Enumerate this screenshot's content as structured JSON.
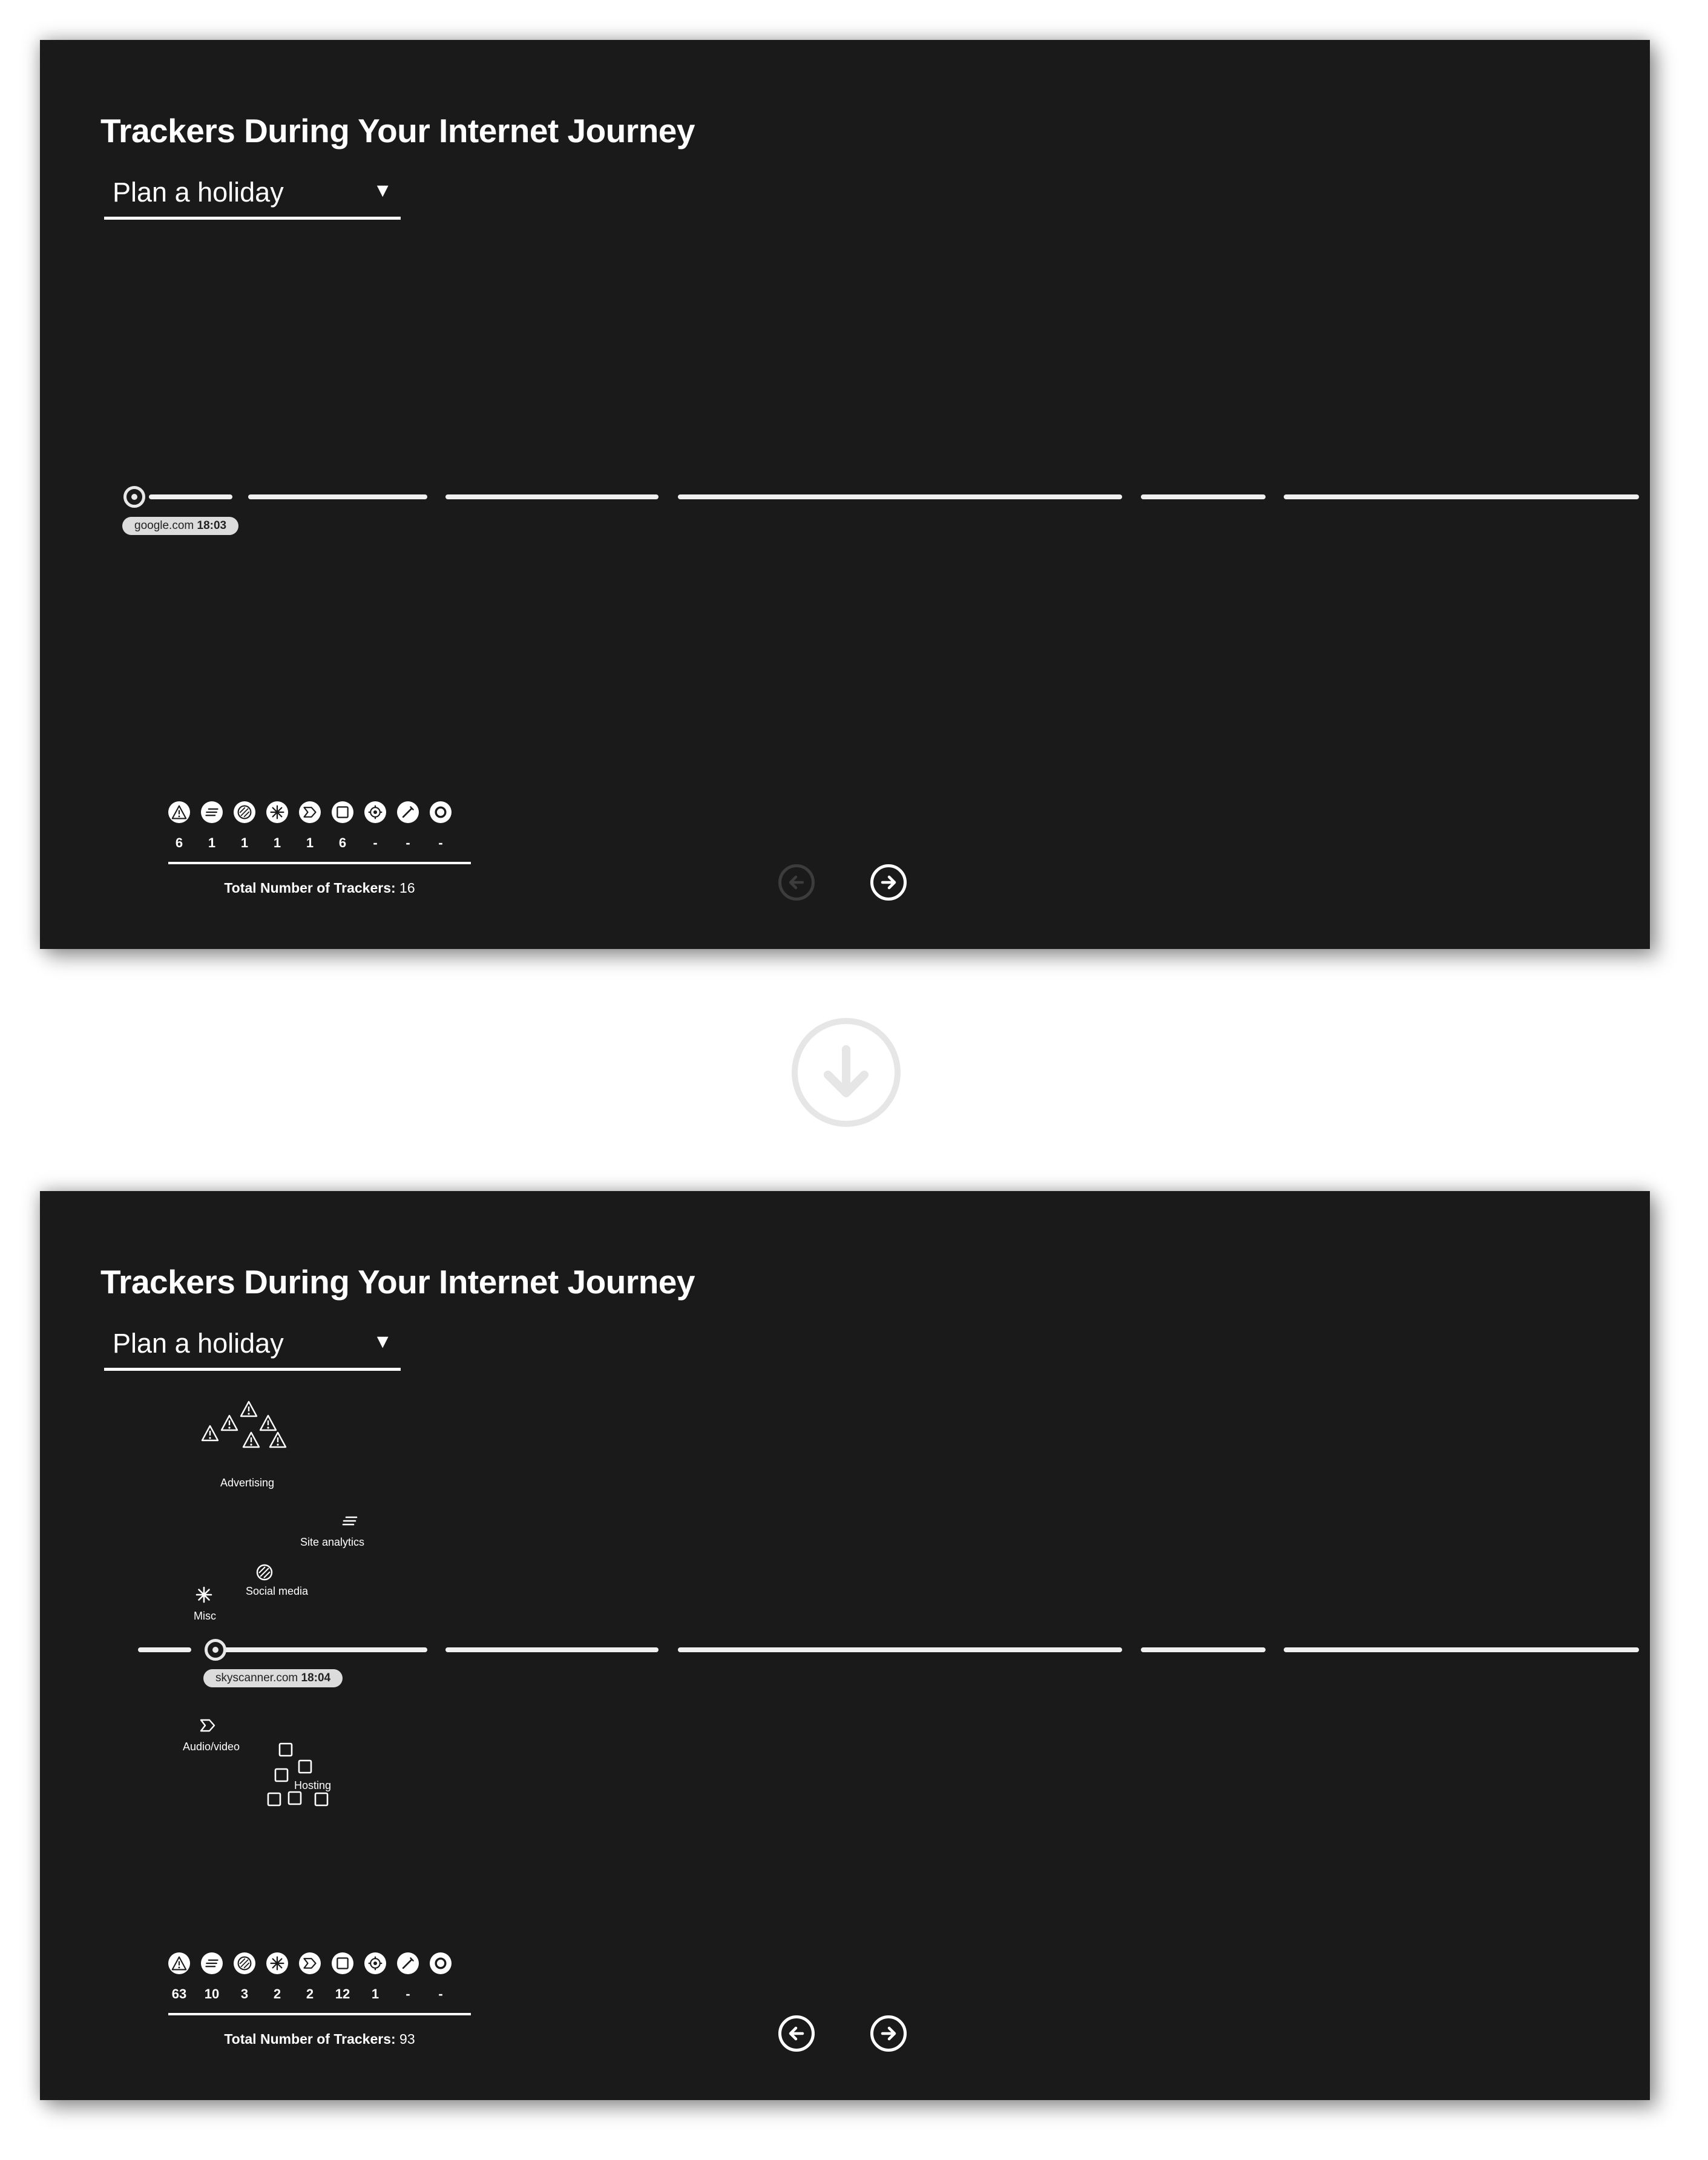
{
  "panels": [
    {
      "title": "Trackers During Your Internet Journey",
      "selector": {
        "value": "Plan a holiday",
        "caret": "▼"
      },
      "current_site": {
        "domain": "google.com",
        "time": "18:03"
      },
      "counts": [
        "6",
        "1",
        "1",
        "1",
        "1",
        "6",
        "-",
        "-",
        "-"
      ],
      "total_label": "Total Number of Trackers:",
      "total_value": "16",
      "prev_enabled": false,
      "next_enabled": true
    },
    {
      "title": "Trackers During Your Internet Journey",
      "selector": {
        "value": "Plan a holiday",
        "caret": "▼"
      },
      "current_site": {
        "domain": "skyscanner.com",
        "time": "18:04"
      },
      "counts": [
        "63",
        "10",
        "3",
        "2",
        "2",
        "12",
        "1",
        "-",
        "-"
      ],
      "total_label": "Total Number of Trackers:",
      "total_value": "93",
      "prev_enabled": true,
      "next_enabled": true,
      "tracker_clusters": [
        {
          "label": "Advertising",
          "icon": "triangle-warning-icon",
          "count_shown": 7
        },
        {
          "label": "Site analytics",
          "icon": "lines-icon",
          "count_shown": 1
        },
        {
          "label": "Social media",
          "icon": "hatched-circle-icon",
          "count_shown": 1
        },
        {
          "label": "Misc",
          "icon": "asterisk-icon",
          "count_shown": 1
        },
        {
          "label": "Audio/video",
          "icon": "play-chevron-icon",
          "count_shown": 1
        },
        {
          "label": "Hosting",
          "icon": "square-icon",
          "count_shown": 7
        }
      ]
    }
  ],
  "legend_icons": [
    "triangle-warning-icon",
    "lines-icon",
    "hatched-circle-icon",
    "asterisk-icon",
    "play-chevron-icon",
    "square-icon",
    "gear-icon",
    "pencil-icon",
    "ring-icon"
  ],
  "colors": {
    "panel_bg": "#1a1a1a",
    "foreground": "#ffffff",
    "disabled": "#3c3c3c",
    "tag_bg": "#dcdcdc"
  }
}
